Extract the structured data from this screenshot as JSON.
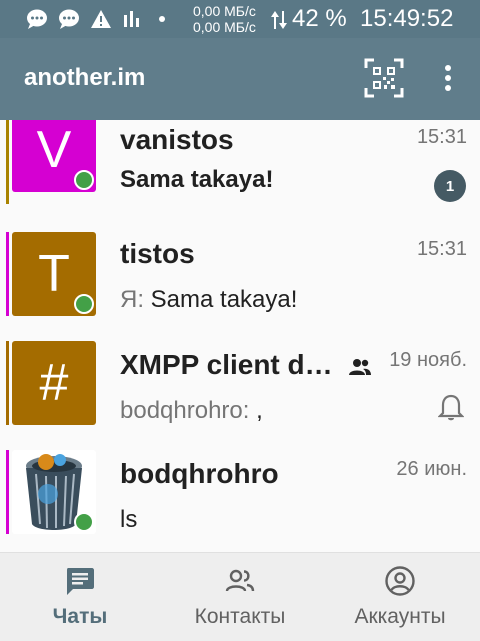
{
  "status_bar": {
    "speed_up": "0,00 МБ/с",
    "speed_down": "0,00 МБ/с",
    "battery": "42 %",
    "time": "15:49:52",
    "icons": [
      "chat-bubble-icon",
      "chat-bubble-icon",
      "warning-icon",
      "signal-bars-icon",
      "dot-icon",
      "data-arrows-icon"
    ]
  },
  "app_bar": {
    "title": "another.im",
    "qr_icon": "qr-code-icon",
    "menu_icon": "more-vert-icon"
  },
  "chats": [
    {
      "name": "vanistos",
      "time": "15:31",
      "avatar_letter": "V",
      "avatar_color": "#d500d2",
      "accent_color": "#a98300",
      "message": "Sama takaya!",
      "unread": "1",
      "online": true
    },
    {
      "name": "tistos",
      "time": "15:31",
      "avatar_letter": "T",
      "avatar_color": "#a46c00",
      "accent_color": "#d500d2",
      "sender": "Я:",
      "message": "Sama takaya!",
      "online": true
    },
    {
      "name": "XMPP client d…",
      "time": "19 нояб.",
      "avatar_letter": "#",
      "avatar_color": "#a46c00",
      "accent_color": "#a46c00",
      "sender": "bodqhrohro:",
      "message": ",",
      "group_icon": "group-icon",
      "muted_icon": "bell-icon"
    },
    {
      "name": "bodqhrohro",
      "time": "26 июн.",
      "avatar_image": "trash-bin-avatar",
      "accent_color": "#d500d2",
      "message": "ls",
      "online": true
    }
  ],
  "bottom_nav": {
    "tabs": [
      {
        "label": "Чаты",
        "icon": "chat-icon",
        "active": true
      },
      {
        "label": "Контакты",
        "icon": "contacts-icon",
        "active": false
      },
      {
        "label": "Аккаунты",
        "icon": "account-icon",
        "active": false
      }
    ]
  },
  "colors": {
    "status_bar": "#5a7886",
    "app_bar": "#607d8b",
    "presence_online": "#43a047",
    "badge": "#455a64"
  }
}
